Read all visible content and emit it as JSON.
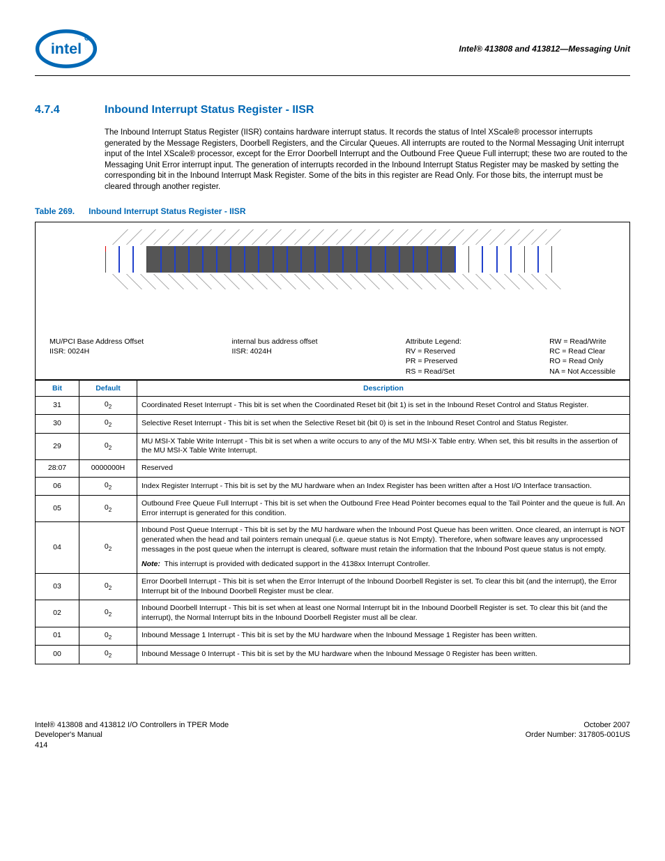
{
  "header": {
    "title": "Intel® 413808 and 413812—Messaging Unit"
  },
  "section": {
    "number": "4.7.4",
    "title": "Inbound Interrupt Status Register - IISR"
  },
  "paragraph": "The Inbound Interrupt Status Register (IISR) contains hardware interrupt status. It records the status of Intel XScale® processor interrupts generated by the Message Registers, Doorbell Registers, and the Circular Queues. All interrupts are routed to the Normal Messaging Unit interrupt input of the Intel XScale® processor, except for the Error Doorbell Interrupt and the Outbound Free Queue Full interrupt; these two are routed to the Messaging Unit Error interrupt input. The generation of interrupts recorded in the Inbound Interrupt Status Register may be masked by setting the corresponding bit in the Inbound Interrupt Mask Register. Some of the bits in this register are Read Only. For those bits, the interrupt must be cleared through another register.",
  "table_caption": {
    "label": "Table 269.",
    "title": "Inbound Interrupt Status Register - IISR"
  },
  "diagram": {
    "offset_label1": "MU/PCI Base Address Offset",
    "offset_value1": "IISR: 0024H",
    "offset_label2": "internal bus address offset",
    "offset_value2": "IISR: 4024H",
    "legend_title": "Attribute Legend:",
    "legend1": "RV = Reserved\nPR = Preserved\nRS = Read/Set",
    "legend2": "RW = Read/Write\nRC = Read Clear\nRO = Read Only\nNA = Not Accessible"
  },
  "table_headers": {
    "bit": "Bit",
    "default": "Default",
    "description": "Description"
  },
  "rows": [
    {
      "bit": "31",
      "def": "0",
      "sub": "2",
      "desc": "Coordinated Reset Interrupt - This bit is set when the Coordinated Reset bit (bit 1) is set in the Inbound Reset Control and Status Register."
    },
    {
      "bit": "30",
      "def": "0",
      "sub": "2",
      "desc": "Selective Reset Interrupt - This bit is set when the Selective Reset bit (bit 0) is set in the Inbound Reset Control and Status Register."
    },
    {
      "bit": "29",
      "def": "0",
      "sub": "2",
      "desc": "MU MSI-X Table Write Interrupt - This bit is set when a write occurs to any of the MU MSI-X Table entry. When set, this bit results in the assertion of the MU MSI-X Table Write Interrupt."
    },
    {
      "bit": "28:07",
      "def": "0000000H",
      "sub": "",
      "desc": "Reserved"
    },
    {
      "bit": "06",
      "def": "0",
      "sub": "2",
      "desc": "Index Register Interrupt - This bit is set by the MU hardware when an Index Register has been written after a Host I/O Interface transaction."
    },
    {
      "bit": "05",
      "def": "0",
      "sub": "2",
      "desc": "Outbound Free Queue Full Interrupt - This bit is set when the Outbound Free Head Pointer becomes equal to the Tail Pointer and the queue is full. An Error interrupt is generated for this condition."
    },
    {
      "bit": "04",
      "def": "0",
      "sub": "2",
      "desc": "Inbound Post Queue Interrupt - This bit is set by the MU hardware when the Inbound Post Queue has been written. Once cleared, an interrupt is NOT generated when the head and tail pointers remain unequal (i.e. queue status is Not Empty). Therefore, when software leaves any unprocessed messages in the post queue when the interrupt is cleared, software must retain the information that the Inbound Post queue status is not empty.",
      "note": "This interrupt is provided with dedicated support in the 4138xx Interrupt Controller."
    },
    {
      "bit": "03",
      "def": "0",
      "sub": "2",
      "desc": "Error Doorbell Interrupt - This bit is set when the Error Interrupt of the Inbound Doorbell Register is set. To clear this bit (and the interrupt), the Error Interrupt bit of the Inbound Doorbell Register must be clear."
    },
    {
      "bit": "02",
      "def": "0",
      "sub": "2",
      "desc": "Inbound Doorbell Interrupt - This bit is set when at least one Normal Interrupt bit in the Inbound Doorbell Register is set. To clear this bit (and the interrupt), the Normal Interrupt bits in the Inbound Doorbell Register must all be clear."
    },
    {
      "bit": "01",
      "def": "0",
      "sub": "2",
      "desc": "Inbound Message 1 Interrupt - This bit is set by the MU hardware when the Inbound Message 1 Register has been written."
    },
    {
      "bit": "00",
      "def": "0",
      "sub": "2",
      "desc": "Inbound Message 0 Interrupt - This bit is set by the MU hardware when the Inbound Message 0 Register has been written."
    }
  ],
  "note_label": "Note:",
  "footer": {
    "left1": "Intel® 413808 and 413812 I/O Controllers in TPER Mode",
    "left2": "Developer's Manual",
    "left3": "414",
    "right1": "October 2007",
    "right2": "Order Number: 317805-001US"
  }
}
